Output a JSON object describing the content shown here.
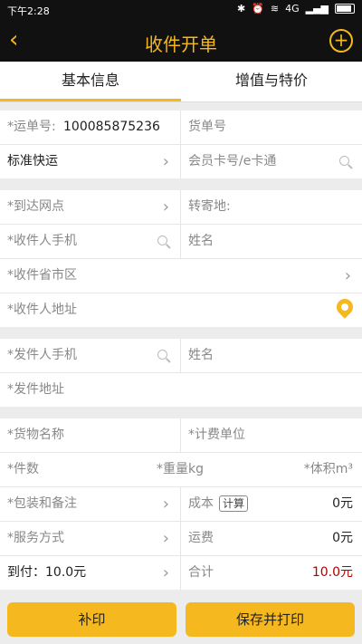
{
  "status_bar": {
    "time": "下午2:28",
    "network": "4G",
    "battery_icon": "battery-icon"
  },
  "header": {
    "title": "收件开单",
    "back_icon": "chevron-left-icon",
    "add_icon": "plus-circle-icon"
  },
  "tabs": [
    {
      "label": "基本信息",
      "active": true
    },
    {
      "label": "增值与特价",
      "active": false
    }
  ],
  "waybill": {
    "waybill_no_label": "*运单号:",
    "waybill_no_value": "100085875236",
    "goods_no_placeholder": "货单号",
    "service_type": "标准快运",
    "member_card_placeholder": "会员卡号/e卡通"
  },
  "receiver": {
    "arrival_site_label": "*到达网点",
    "transfer_label": "转寄地:",
    "phone_label": "*收件人手机",
    "name_label": "姓名",
    "region_label": "*收件省市区",
    "address_label": "*收件人地址"
  },
  "sender": {
    "phone_label": "*发件人手机",
    "name_label": "姓名",
    "address_label": "*发件地址"
  },
  "goods": {
    "name_label": "*货物名称",
    "billing_unit_label": "*计费单位",
    "pieces_label": "*件数",
    "weight_label": "*重量kg",
    "volume_label": "*体积m³",
    "packing_label": "*包装和备注",
    "cost_label": "成本",
    "calc_button": "计算",
    "cost_value": "0元",
    "service_mode_label": "*服务方式",
    "freight_label": "运费",
    "freight_value": "0元",
    "cod_label": "到付：10.0元",
    "total_label": "合计",
    "total_value": "10.0元"
  },
  "buttons": {
    "reprint": "补印",
    "save_print": "保存并打印"
  },
  "colors": {
    "accent": "#f5b81e",
    "header_bg": "#111111",
    "total_red": "#b00000"
  }
}
